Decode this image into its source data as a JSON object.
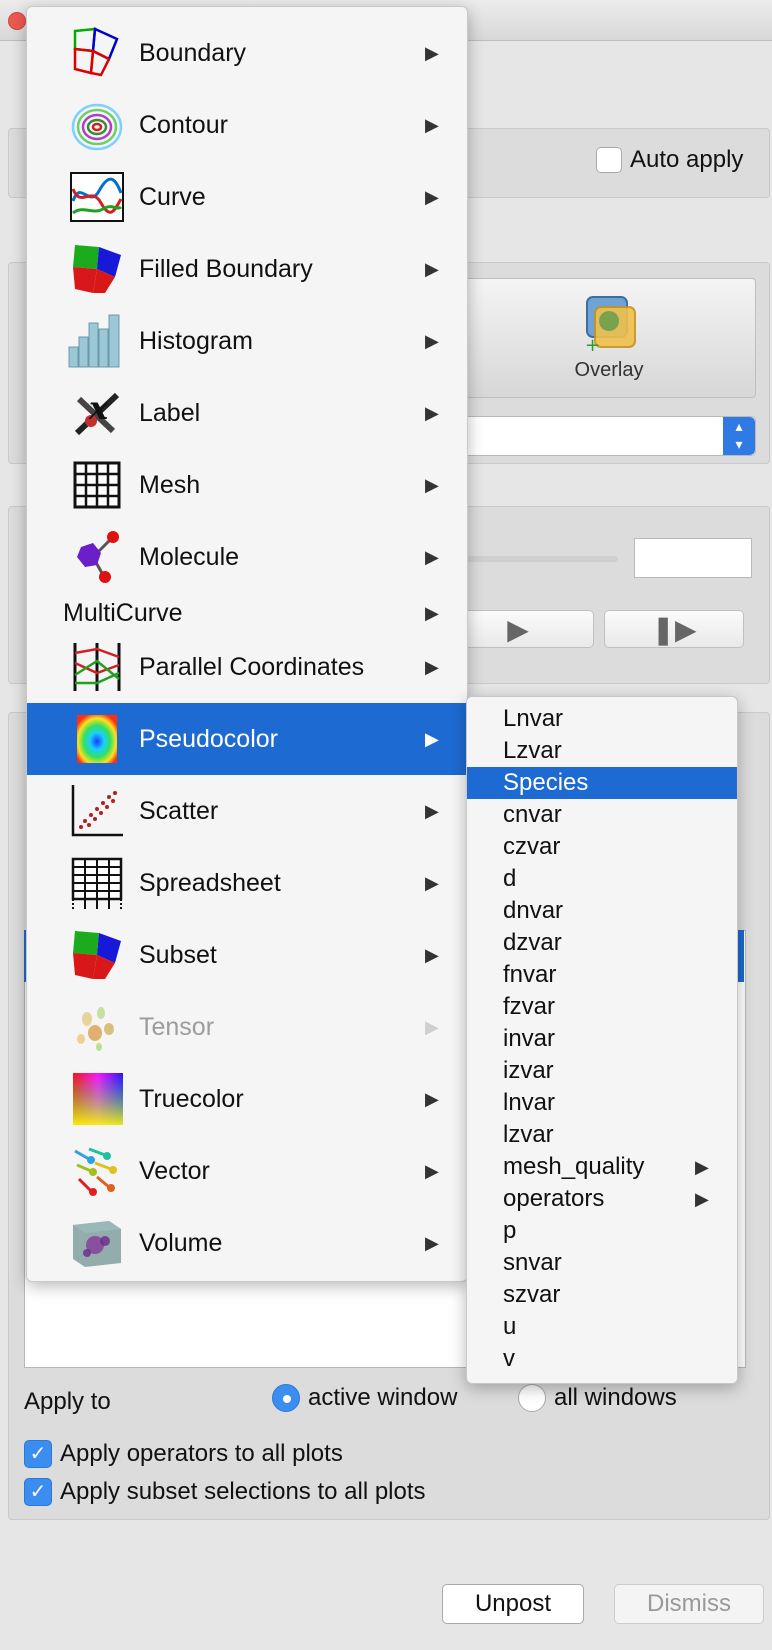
{
  "auto_apply": {
    "label": "Auto apply",
    "checked": false
  },
  "overlay": {
    "label": "Overlay"
  },
  "plot_menu": {
    "items": [
      {
        "label": "Boundary",
        "icon": "boundary-icon",
        "has_submenu": true
      },
      {
        "label": "Contour",
        "icon": "contour-icon",
        "has_submenu": true
      },
      {
        "label": "Curve",
        "icon": "curve-icon",
        "has_submenu": true
      },
      {
        "label": "Filled Boundary",
        "icon": "filled-boundary-icon",
        "has_submenu": true
      },
      {
        "label": "Histogram",
        "icon": "histogram-icon",
        "has_submenu": true
      },
      {
        "label": "Label",
        "icon": "label-icon",
        "has_submenu": true
      },
      {
        "label": "Mesh",
        "icon": "mesh-icon",
        "has_submenu": true
      },
      {
        "label": "Molecule",
        "icon": "molecule-icon",
        "has_submenu": true
      },
      {
        "label": "MultiCurve",
        "icon": "",
        "has_submenu": true
      },
      {
        "label": "Parallel Coordinates",
        "icon": "parallel-coordinates-icon",
        "has_submenu": true
      },
      {
        "label": "Pseudocolor",
        "icon": "pseudocolor-icon",
        "has_submenu": true,
        "selected": true
      },
      {
        "label": "Scatter",
        "icon": "scatter-icon",
        "has_submenu": true
      },
      {
        "label": "Spreadsheet",
        "icon": "spreadsheet-icon",
        "has_submenu": true
      },
      {
        "label": "Subset",
        "icon": "subset-icon",
        "has_submenu": true
      },
      {
        "label": "Tensor",
        "icon": "tensor-icon",
        "has_submenu": true,
        "disabled": true
      },
      {
        "label": "Truecolor",
        "icon": "truecolor-icon",
        "has_submenu": true
      },
      {
        "label": "Vector",
        "icon": "vector-icon",
        "has_submenu": true
      },
      {
        "label": "Volume",
        "icon": "volume-icon",
        "has_submenu": true
      }
    ]
  },
  "variable_submenu": {
    "items": [
      {
        "label": "Lnvar"
      },
      {
        "label": "Lzvar"
      },
      {
        "label": "Species",
        "selected": true
      },
      {
        "label": "cnvar"
      },
      {
        "label": "czvar"
      },
      {
        "label": "d"
      },
      {
        "label": "dnvar"
      },
      {
        "label": "dzvar"
      },
      {
        "label": "fnvar"
      },
      {
        "label": "fzvar"
      },
      {
        "label": "invar"
      },
      {
        "label": "izvar"
      },
      {
        "label": "lnvar"
      },
      {
        "label": "lzvar"
      },
      {
        "label": "mesh_quality",
        "has_submenu": true
      },
      {
        "label": "operators",
        "has_submenu": true
      },
      {
        "label": "p"
      },
      {
        "label": "snvar"
      },
      {
        "label": "szvar"
      },
      {
        "label": "u"
      },
      {
        "label": "v"
      }
    ]
  },
  "apply_to": {
    "label": "Apply to",
    "options": [
      {
        "label": "active window",
        "selected": true
      },
      {
        "label": "all windows",
        "selected": false
      }
    ]
  },
  "checkboxes": [
    {
      "label": "Apply operators to all plots",
      "checked": true
    },
    {
      "label": "Apply subset selections to all plots",
      "checked": true
    }
  ],
  "buttons": {
    "unpost": "Unpost",
    "dismiss": "Dismiss"
  },
  "colors": {
    "accent": "#1d6ad2",
    "checkbox_blue": "#3b8ef0"
  }
}
